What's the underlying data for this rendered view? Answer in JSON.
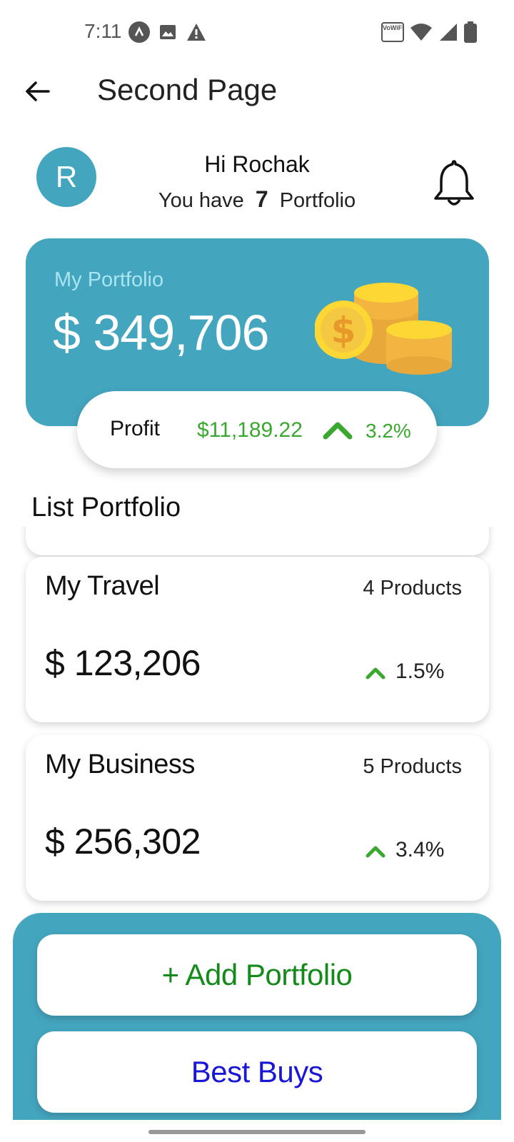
{
  "status_bar": {
    "time": "7:11",
    "left_icons": [
      "app-a-icon",
      "image-icon",
      "warning-icon"
    ],
    "right_icons": [
      "vowifi-icon",
      "wifi-icon",
      "signal-icon",
      "battery-icon"
    ],
    "vowifi_text": "VoWiFi"
  },
  "app_bar": {
    "title": "Second Page"
  },
  "header": {
    "avatar_letter": "R",
    "greeting": "Hi Rochak",
    "count_prefix": "You have",
    "count": "7",
    "count_suffix": "Portfolio"
  },
  "portfolio": {
    "label": "My Portfolio",
    "value": "$ 349,706",
    "profit_label": "Profit",
    "profit_value": "$11,189.22",
    "profit_pct": "3.2%"
  },
  "list": {
    "title": "List Portfolio",
    "items": [
      {
        "name": "My Travel",
        "products": "4 Products",
        "value": "$ 123,206",
        "pct": "1.5%"
      },
      {
        "name": "My Business",
        "products": "5 Products",
        "value": "$ 256,302",
        "pct": "3.4%"
      }
    ]
  },
  "actions": {
    "add_label": "+ Add Portfolio",
    "best_label": "Best Buys"
  },
  "colors": {
    "accent": "#44a5bf",
    "profit_green": "#3aa82f",
    "add_green": "#138a1a",
    "best_blue": "#1a16d6"
  }
}
